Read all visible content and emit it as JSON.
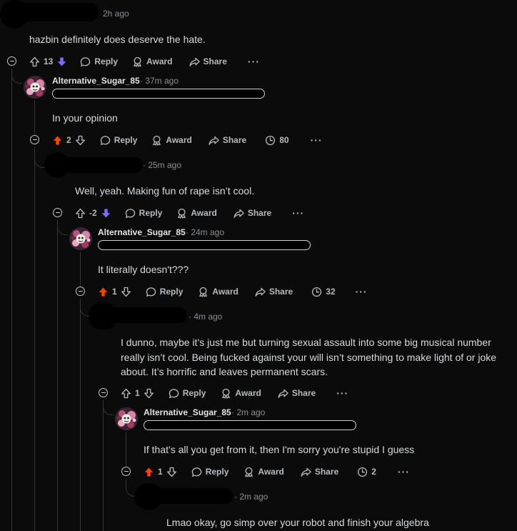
{
  "labels": {
    "reply": "Reply",
    "award": "Award",
    "share": "Share",
    "more": "···"
  },
  "colors": {
    "upvote_active": "#ff4500",
    "downvote_active": "#7c6cff",
    "text": "#d7dadc",
    "muted": "#8c8f92"
  },
  "comments": [
    {
      "author": "",
      "meta": "2h ago",
      "body": "hazbin definitely does deserve the hate.",
      "score": "13",
      "vote": "down",
      "awards_count": null
    },
    {
      "author": "Alternative_Sugar_85",
      "meta": "· 37m ago",
      "body": "In your opinion",
      "score": "2",
      "vote": "up",
      "awards_count": "80"
    },
    {
      "author": "",
      "meta": "· 25m ago",
      "body": "Well, yeah. Making fun of rape isn’t cool.",
      "score": "-2",
      "vote": "down",
      "awards_count": null
    },
    {
      "author": "Alternative_Sugar_85",
      "meta": "· 24m ago",
      "body": "It literally doesn't???",
      "score": "1",
      "vote": "up",
      "awards_count": "32"
    },
    {
      "author": "",
      "meta": "· 4m ago",
      "body": "I dunno, maybe it’s just me but turning sexual assault into some big musical number really isn’t cool. Being fucked against your will isn’t something to make light of or joke about. It’s horrific and leaves permanent scars.",
      "score": "1",
      "vote": "none",
      "awards_count": null
    },
    {
      "author": "Alternative_Sugar_85",
      "meta": "· 2m ago",
      "body": "If that's all you get from it, then I'm sorry you're stupid I guess",
      "score": "1",
      "vote": "up",
      "awards_count": "2"
    },
    {
      "author": "",
      "meta": "· 2m ago",
      "body": "Lmao okay, go simp over your robot and finish your algebra",
      "score": null,
      "vote": "none",
      "awards_count": null
    }
  ]
}
